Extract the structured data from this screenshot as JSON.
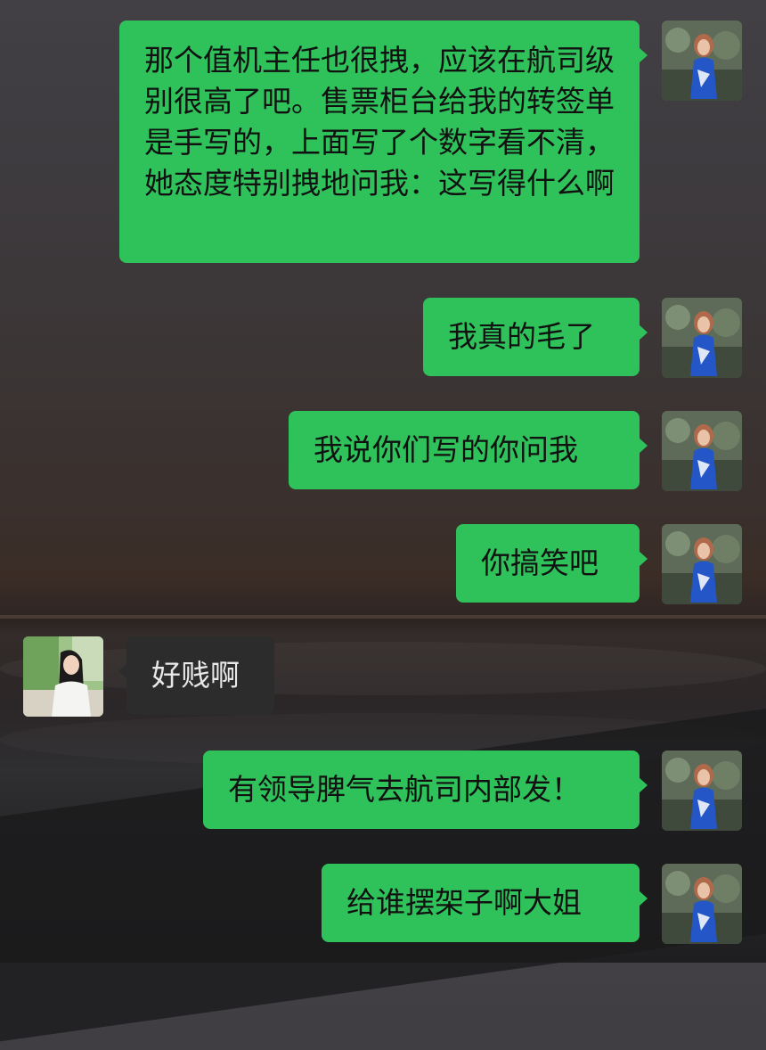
{
  "chat": {
    "messages": [
      {
        "sender": "me",
        "text": "那个值机主任也很拽，应该在航司级别很高了吧。售票柜台给我的转签单是手写的，上面写了个数字看不清，她态度特别拽地问我：这写得什么啊"
      },
      {
        "sender": "me",
        "text": "我真的毛了"
      },
      {
        "sender": "me",
        "text": "我说你们写的你问我"
      },
      {
        "sender": "me",
        "text": "你搞笑吧"
      },
      {
        "sender": "them",
        "text": "好贱啊"
      },
      {
        "sender": "me",
        "text": "有领导脾气去航司内部发！"
      },
      {
        "sender": "me",
        "text": "给谁摆架子啊大姐"
      }
    ]
  },
  "colors": {
    "my_bubble": "#2fc25b",
    "their_bubble": "#2c2c2c"
  }
}
